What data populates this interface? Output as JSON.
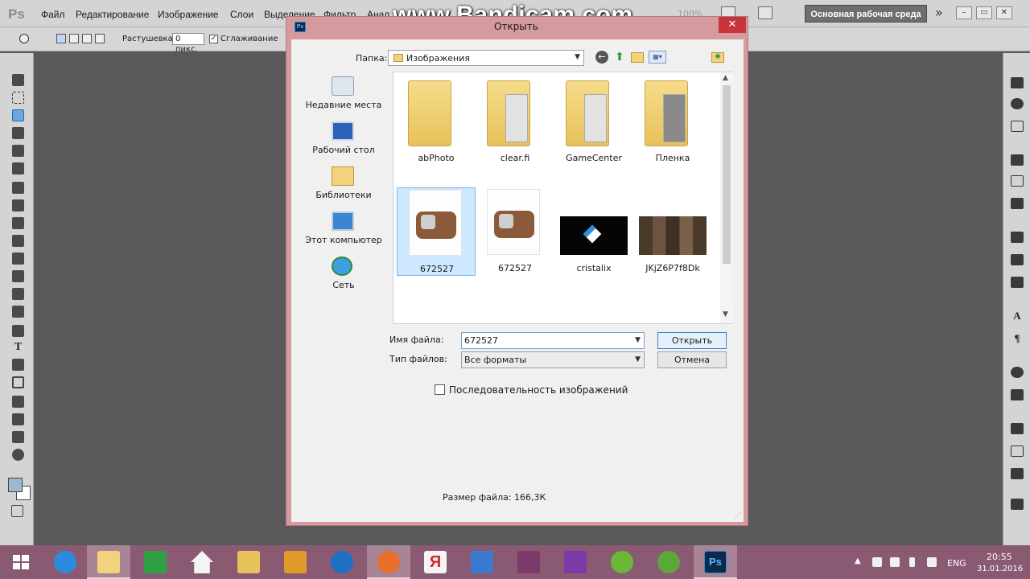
{
  "menubar": {
    "logo": "Ps",
    "items": [
      "Файл",
      "Редактирование",
      "Изображение",
      "Слои",
      "Выделение",
      "Фильтр",
      "Анал"
    ],
    "zoom": "100%",
    "workspace": "Основная рабочая среда",
    "more_glyph": "»"
  },
  "watermark": "www.Bandicam.com",
  "options": {
    "feather_label": "Растушевка:",
    "feather_value": "0 пикс.",
    "antialias_label": "Сглаживание",
    "antialias_checked": true
  },
  "dialog": {
    "title": "Открыть",
    "close_glyph": "✕",
    "lookin_label": "Папка:",
    "lookin_value": "Изображения",
    "places": [
      {
        "label": "Недавние места",
        "icon": "recent-places-icon"
      },
      {
        "label": "Рабочий стол",
        "icon": "desktop-icon"
      },
      {
        "label": "Библиотеки",
        "icon": "libraries-icon"
      },
      {
        "label": "Этот компьютер",
        "icon": "computer-icon"
      },
      {
        "label": "Сеть",
        "icon": "network-icon"
      }
    ],
    "files": [
      {
        "name": "abPhoto",
        "kind": "folder"
      },
      {
        "name": "clear.fi",
        "kind": "folder"
      },
      {
        "name": "GameCenter",
        "kind": "folder"
      },
      {
        "name": "Пленка",
        "kind": "folder"
      },
      {
        "name": "672527",
        "kind": "image",
        "selected": true
      },
      {
        "name": "672527",
        "kind": "image"
      },
      {
        "name": "cristalix",
        "kind": "image"
      },
      {
        "name": "JKjZ6P7f8Dk",
        "kind": "image"
      }
    ],
    "filename_label": "Имя файла:",
    "filename_value": "672527",
    "filetype_label": "Тип файлов:",
    "filetype_value": "Все форматы",
    "open_label": "Открыть",
    "cancel_label": "Отмена",
    "sequence_label": "Последовательность изображений",
    "filesize_text": "Размер файла: 166,3К"
  },
  "taskbar": {
    "language": "ENG",
    "time": "20:55",
    "date": "31.01.2016",
    "apps": [
      "internet-explorer-icon",
      "file-explorer-icon",
      "store-icon",
      "home-icon",
      "folder-icon",
      "notes-icon",
      "teamviewer-icon",
      "firefox-icon",
      "yandex-icon",
      "volume-app-icon",
      "winrar-icon",
      "onenote-icon",
      "chat-icon",
      "utorrent-icon",
      "photoshop-icon"
    ],
    "yandex_glyph": "Я",
    "photoshop_glyph": "Ps"
  },
  "colors": {
    "dialog_frame": "#d49a9e",
    "taskbar": "#8a5a72",
    "selection": "#cde8ff",
    "close_button": "#c7343a"
  }
}
